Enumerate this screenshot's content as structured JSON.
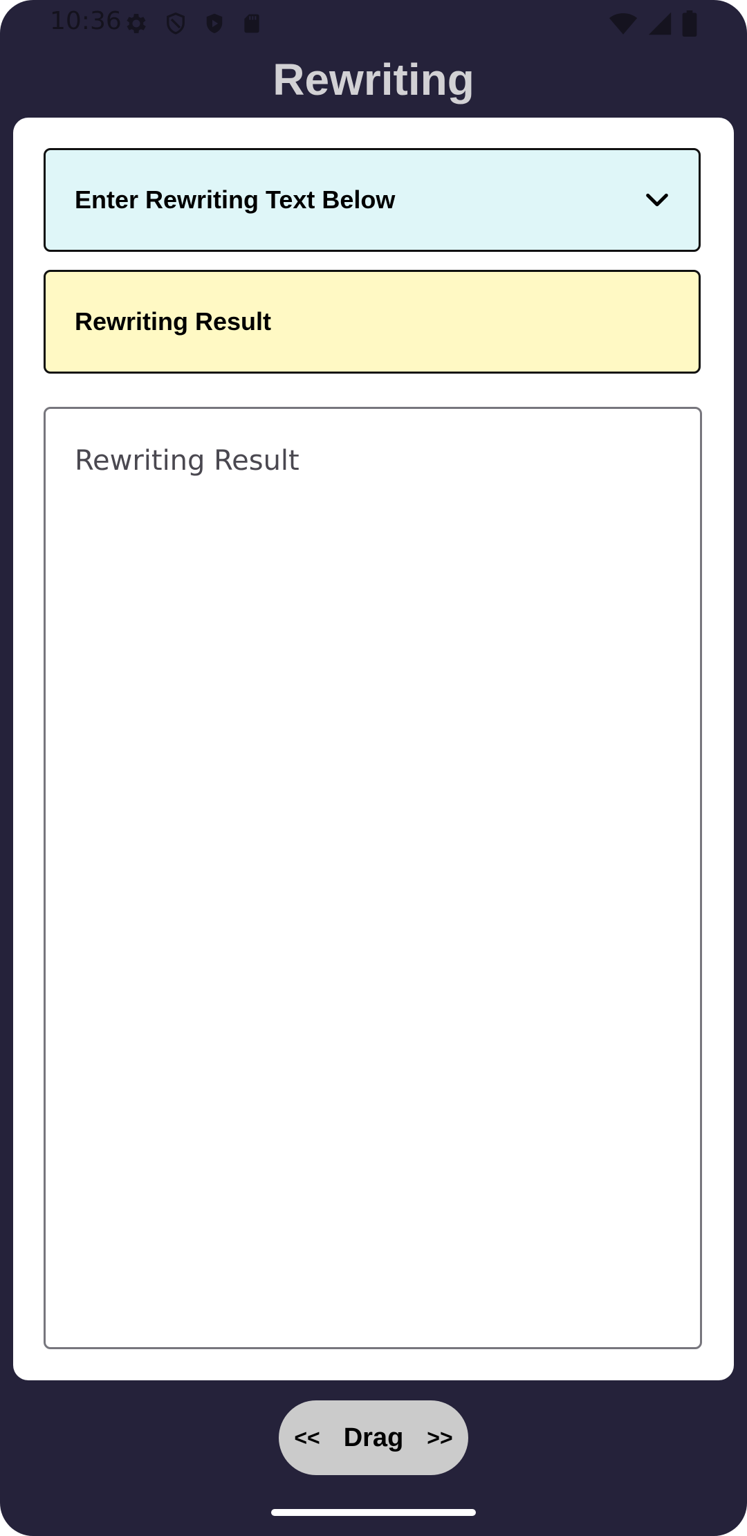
{
  "status_bar": {
    "time": "10:36",
    "left_icons": [
      "gear-icon",
      "shield-outline-icon",
      "shield-play-icon",
      "sd-card-icon"
    ],
    "right_icons": [
      "wifi-icon",
      "cell-signal-icon",
      "battery-icon"
    ]
  },
  "app": {
    "title": "Rewriting"
  },
  "input_panel": {
    "label": "Enter Rewriting Text Below",
    "icon": "chevron-down-icon",
    "background": "#dff6f8"
  },
  "result_panel": {
    "label": "Rewriting Result",
    "background": "#fff9c4"
  },
  "result_field": {
    "placeholder": "Rewriting Result",
    "value": ""
  },
  "drag_handle": {
    "left": "<<",
    "label": "Drag",
    "right": ">>"
  },
  "colors": {
    "window_background": "#25223a",
    "title_text": "#d2d1d4",
    "card_background": "#ffffff",
    "drag_pill": "#cbcbcb"
  }
}
